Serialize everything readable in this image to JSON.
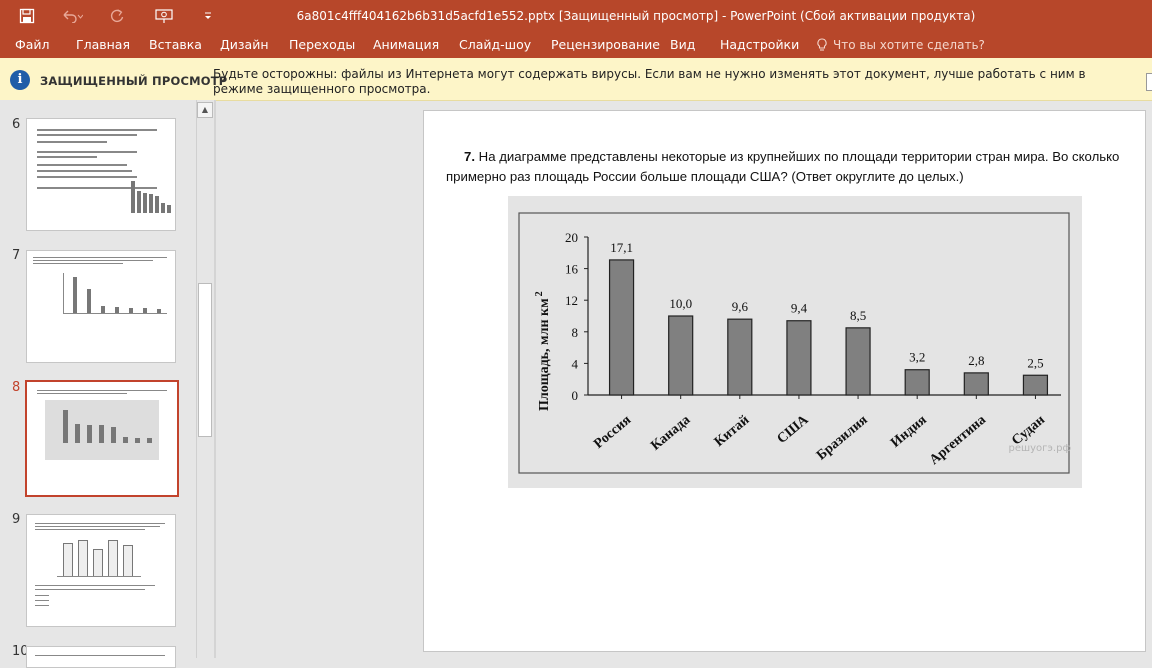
{
  "window": {
    "title": "6a801c4fff404162b6b31d5acfd1e552.pptx [Защищенный просмотр] - PowerPoint (Сбой активации продукта)"
  },
  "qat": {
    "save_icon": "save-icon",
    "undo_icon": "undo-icon",
    "redo_icon": "redo-icon",
    "start_icon": "present-from-start-icon",
    "customize_icon": "customize-qat-icon"
  },
  "menu": {
    "items": [
      "Файл",
      "Главная",
      "Вставка",
      "Дизайн",
      "Переходы",
      "Анимация",
      "Слайд-шоу",
      "Рецензирование",
      "Вид",
      "Надстройки"
    ],
    "tell_me": "Что вы хотите сделать?"
  },
  "protected": {
    "title": "ЗАЩИЩЕННЫЙ ПРОСМОТР",
    "message": "Будьте осторожны: файлы из Интернета могут содержать вирусы. Если вам не нужно изменять этот документ, лучше работать с ним в режиме защищенного просмотра."
  },
  "slides_panel": {
    "numbers": [
      "6",
      "7",
      "8",
      "9",
      "10"
    ],
    "selected": "8"
  },
  "slide": {
    "question_number": "7.",
    "question_text": "На диаграмме представлены некоторые из крупнейших по площади территории стран мира. Во сколько примерно раз площадь России больше площади США? (Ответ округлите до целых.)",
    "watermark": "решуогэ.рф"
  },
  "chart_data": {
    "type": "bar",
    "categories": [
      "Россия",
      "Канада",
      "Китай",
      "США",
      "Бразилия",
      "Индия",
      "Аргентина",
      "Судан"
    ],
    "values": [
      17.1,
      10.0,
      9.6,
      9.4,
      8.5,
      3.2,
      2.8,
      2.5
    ],
    "value_labels": [
      "17,1",
      "10,0",
      "9,6",
      "9,4",
      "8,5",
      "3,2",
      "2,8",
      "2,5"
    ],
    "ylabel": "Площадь, млн км",
    "ylabel_sup": "2",
    "yticks": [
      "0",
      "4",
      "8",
      "12",
      "16",
      "20"
    ],
    "ylim": [
      0,
      20
    ],
    "bar_color": "#808080"
  },
  "colors": {
    "accent": "#b7472a",
    "selected_border": "#c2432c",
    "protected_bg": "#fdf5c8"
  }
}
